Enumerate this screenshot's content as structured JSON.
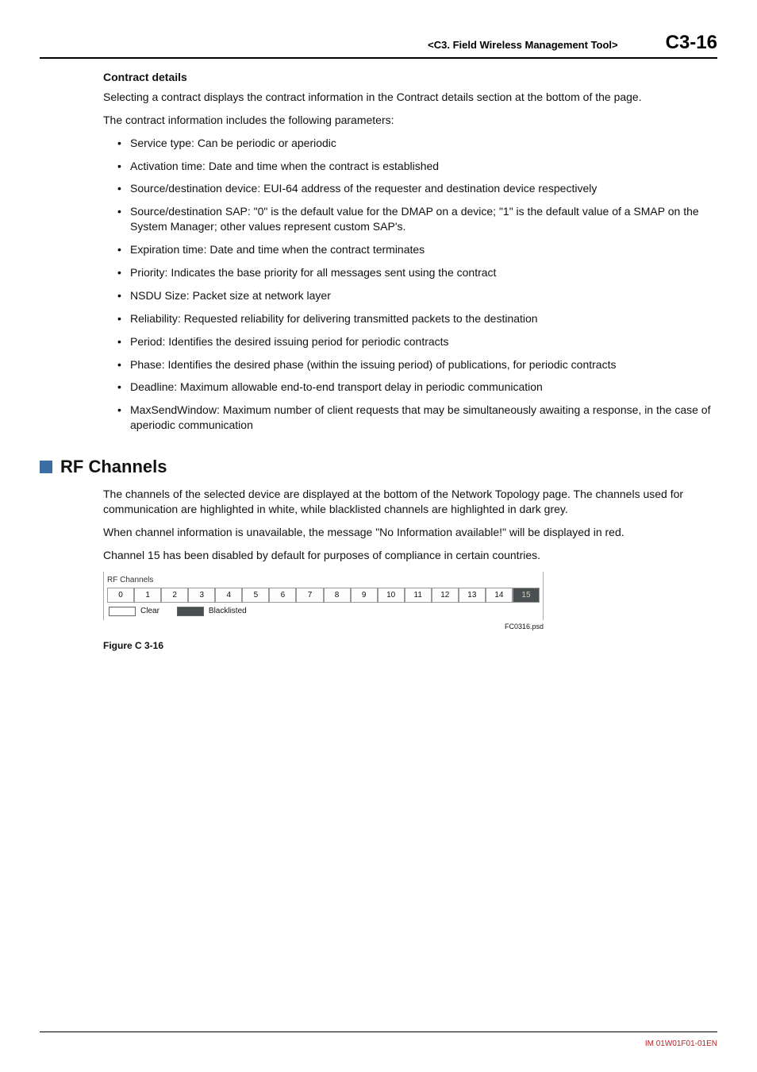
{
  "header": {
    "chapter": "<C3.  Field Wireless Management Tool>",
    "page": "C3-16"
  },
  "contract": {
    "title": "Contract details",
    "p1": "Selecting a contract displays the contract information in the Contract details section at the bottom of the page.",
    "p2": "The contract information includes the following parameters:",
    "items": [
      "Service type: Can be periodic or aperiodic",
      "Activation time: Date and time when the contract is established",
      "Source/destination device: EUI-64 address of the requester and destination device respectively",
      "Source/destination SAP: \"0\" is the default value for the DMAP on a device; \"1\" is the default value of a SMAP on the System Manager; other values represent custom SAP's.",
      "Expiration time: Date and time when the contract terminates",
      "Priority: Indicates the base priority for all messages sent using the contract",
      "NSDU Size: Packet size at network layer",
      "Reliability: Requested reliability for delivering transmitted packets to the destination",
      "Period: Identifies the desired issuing period for periodic contracts",
      "Phase: Identifies the desired phase (within the issuing period) of publications, for periodic contracts",
      "Deadline: Maximum allowable end-to-end transport delay in periodic communication",
      "MaxSendWindow: Maximum number of client requests that may be simultaneously awaiting a response, in the case of aperiodic communication"
    ]
  },
  "rf": {
    "title": "RF Channels",
    "p1": "The channels of the selected device are displayed at the bottom of the Network Topology page. The channels used for communication are highlighted in white, while blacklisted channels are highlighted in dark grey.",
    "p2": "When channel information is unavailable, the message \"No Information available!\" will be displayed in red.",
    "p3": "Channel 15 has been disabled by default for purposes of compliance in certain countries.",
    "fig": {
      "panel_label": "RF Channels",
      "channels": [
        "0",
        "1",
        "2",
        "3",
        "4",
        "5",
        "6",
        "7",
        "8",
        "9",
        "10",
        "11",
        "12",
        "13",
        "14",
        "15"
      ],
      "blacklisted_index": 15,
      "legend_clear": "Clear",
      "legend_black": "Blacklisted",
      "psd": "FC0316.psd",
      "caption": "Figure C 3-16"
    }
  },
  "footer": {
    "docid": "IM 01W01F01-01EN"
  }
}
